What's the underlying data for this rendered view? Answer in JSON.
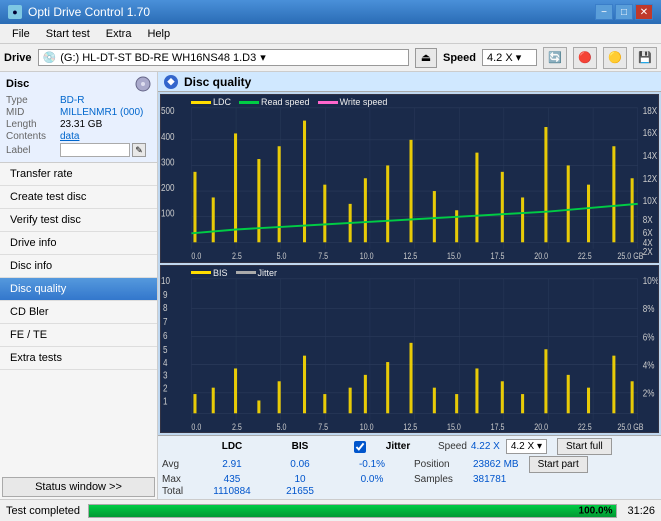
{
  "titleBar": {
    "title": "Opti Drive Control 1.70",
    "minimizeLabel": "−",
    "maximizeLabel": "□",
    "closeLabel": "✕"
  },
  "menuBar": {
    "items": [
      "File",
      "Start test",
      "Extra",
      "Help"
    ]
  },
  "driveBar": {
    "label": "Drive",
    "driveValue": "(G:)  HL-DT-ST BD-RE  WH16NS48 1.D3",
    "speedLabel": "Speed",
    "speedValue": "4.2 X ▾",
    "ejectSymbol": "⏏"
  },
  "sidebar": {
    "discSection": "Disc",
    "discType": "BD-R",
    "discTypeLabel": "Type",
    "midLabel": "MID",
    "midValue": "MILLENMR1 (000)",
    "lengthLabel": "Length",
    "lengthValue": "23.31 GB",
    "contentsLabel": "Contents",
    "contentsValue": "data",
    "labelLabel": "Label",
    "navItems": [
      {
        "id": "transfer-rate",
        "label": "Transfer rate",
        "active": false
      },
      {
        "id": "create-test-disc",
        "label": "Create test disc",
        "active": false
      },
      {
        "id": "verify-test-disc",
        "label": "Verify test disc",
        "active": false
      },
      {
        "id": "drive-info",
        "label": "Drive info",
        "active": false
      },
      {
        "id": "disc-info",
        "label": "Disc info",
        "active": false
      },
      {
        "id": "disc-quality",
        "label": "Disc quality",
        "active": true
      },
      {
        "id": "cd-bler",
        "label": "CD Bler",
        "active": false
      },
      {
        "id": "fe-te",
        "label": "FE / TE",
        "active": false
      },
      {
        "id": "extra-tests",
        "label": "Extra tests",
        "active": false
      }
    ],
    "statusWindowBtn": "Status window >>"
  },
  "contentHeader": {
    "icon": "◆",
    "title": "Disc quality"
  },
  "charts": {
    "upper": {
      "legends": [
        {
          "label": "LDC",
          "color": "#ffdd00"
        },
        {
          "label": "Read speed",
          "color": "#00cc44"
        },
        {
          "label": "Write speed",
          "color": "#ff66cc"
        }
      ],
      "yAxisRight": [
        "18X",
        "16X",
        "14X",
        "12X",
        "10X",
        "8X",
        "6X",
        "4X",
        "2X"
      ],
      "yAxisLeft": [
        "500",
        "400",
        "300",
        "200",
        "100"
      ],
      "xAxisLabels": [
        "0.0",
        "2.5",
        "5.0",
        "7.5",
        "10.0",
        "12.5",
        "15.0",
        "17.5",
        "20.0",
        "22.5",
        "25.0 GB"
      ]
    },
    "lower": {
      "legends": [
        {
          "label": "BIS",
          "color": "#ffdd00"
        },
        {
          "label": "Jitter",
          "color": "#aaaaaa"
        }
      ],
      "yAxisRight": [
        "10%",
        "8%",
        "6%",
        "4%",
        "2%"
      ],
      "yAxisLeft": [
        "10",
        "9",
        "8",
        "7",
        "6",
        "5",
        "4",
        "3",
        "2",
        "1"
      ],
      "xAxisLabels": [
        "0.0",
        "2.5",
        "5.0",
        "7.5",
        "10.0",
        "12.5",
        "15.0",
        "17.5",
        "20.0",
        "22.5",
        "25.0 GB"
      ]
    }
  },
  "statsBar": {
    "columns": [
      "LDC",
      "BIS",
      "",
      "Jitter"
    ],
    "rows": [
      {
        "label": "Avg",
        "ldc": "2.91",
        "bis": "0.06",
        "jitter": "-0.1%"
      },
      {
        "label": "Max",
        "ldc": "435",
        "bis": "10",
        "jitter": "0.0%"
      },
      {
        "label": "Total",
        "ldc": "1110884",
        "bis": "21655",
        "jitter": ""
      }
    ],
    "speedLabel": "Speed",
    "speedValue": "4.22 X",
    "speedDropdown": "4.2 X ▾",
    "positionLabel": "Position",
    "positionValue": "23862 MB",
    "samplesLabel": "Samples",
    "samplesValue": "381781",
    "startFullBtn": "Start full",
    "startPartBtn": "Start part"
  },
  "statusBar": {
    "text": "Test completed",
    "progressPercent": 100,
    "progressText": "100.0%",
    "timeDisplay": "31:26"
  }
}
